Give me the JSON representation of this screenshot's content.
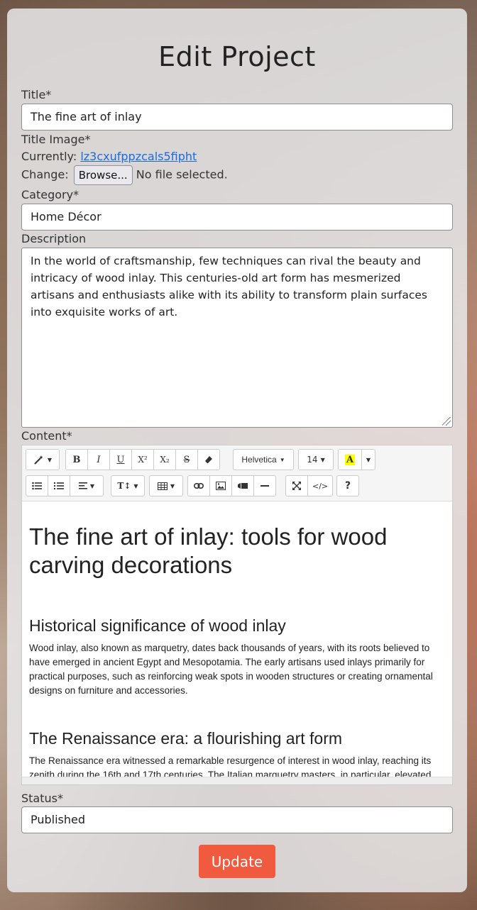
{
  "page": {
    "heading": "Edit Project"
  },
  "form": {
    "title_label": "Title*",
    "title_value": "The fine art of inlay",
    "title_image_label": "Title Image*",
    "currently_label": "Currently:",
    "currently_link": "lz3cxufppzcals5fipht",
    "change_label": "Change:",
    "browse_button": "Browse...",
    "no_file_text": "No file selected.",
    "category_label": "Category*",
    "category_value": "Home Décor",
    "description_label": "Description",
    "description_value": "In the world of craftsmanship, few techniques can rival the beauty and intricacy of wood inlay. This centuries-old art form has mesmerized artisans and enthusiasts alike with its ability to transform plain surfaces into exquisite works of art.",
    "content_label": "Content*",
    "status_label": "Status*",
    "status_value": "Published",
    "update_button": "Update"
  },
  "toolbar": {
    "style_icon": "magic-wand-icon",
    "bold": "B",
    "italic": "I",
    "underline": "U",
    "superscript": "X²",
    "subscript": "X₂",
    "strikethrough": "S",
    "eraser_icon": "eraser-icon",
    "font_family": "Helvetica",
    "font_size": "14",
    "color_letter": "A",
    "unordered_list_icon": "unordered-list-icon",
    "ordered_list_icon": "ordered-list-icon",
    "align_icon": "align-icon",
    "line_height_icon": "line-height-icon",
    "table_icon": "table-icon",
    "link_icon": "link-icon",
    "image_icon": "image-icon",
    "video_icon": "video-icon",
    "hr_icon": "horizontal-rule-icon",
    "fullscreen_icon": "fullscreen-icon",
    "code": "</>",
    "help": "?",
    "highlight_color": "#ffff00"
  },
  "editor": {
    "h1": "The fine art of inlay: tools for wood carving decorations",
    "h2_1": "Historical significance of wood inlay",
    "p_1": "Wood inlay, also known as marquetry, dates back thousands of years, with its roots believed to have emerged in ancient Egypt and Mesopotamia. The early artisans used inlays primarily for practical purposes, such as reinforcing weak spots in wooden structures or creating ornamental designs on furniture and accessories.",
    "h2_2": "The Renaissance era: a flourishing art form",
    "p_2": "The Renaissance era witnessed a remarkable resurgence of interest in wood inlay, reaching its zenith during the 16th and 17th centuries. The Italian marquetry masters, in particular, elevated the craft to new heights."
  },
  "colors": {
    "accent": "#f05a3f",
    "link": "#1a6be0"
  }
}
